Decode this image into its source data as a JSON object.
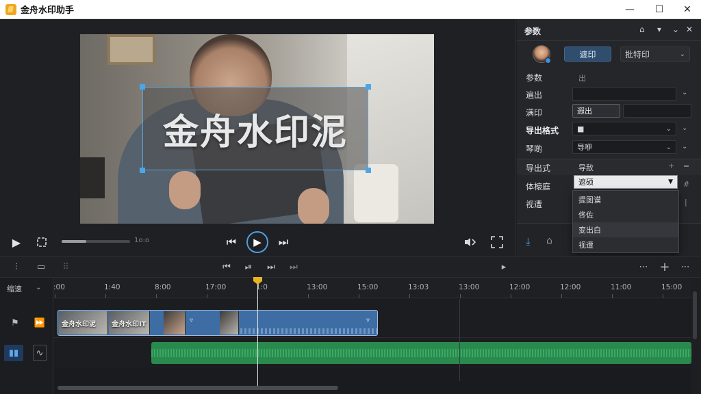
{
  "window": {
    "title": "金舟水印助手",
    "minimize": "—",
    "maximize": "☐",
    "close": "✕"
  },
  "preview": {
    "watermark_text": "金舟水印泥",
    "time": "1o:o"
  },
  "panel": {
    "title": "参数",
    "tab_active": "遮印",
    "tab_other": "批特印",
    "rows": {
      "r1_label": "参数",
      "r1_value": "出",
      "r2_label": "遍出",
      "r3_label": "满印",
      "r3_button": "遐出",
      "r4_label": "导出格式",
      "r4_value": "■",
      "r5_label": "琴啲",
      "r5_value": "导咿"
    },
    "section": {
      "label": "导出式",
      "value": "导敌",
      "plus": "+",
      "eq": "="
    },
    "row6_label": "体榱庭",
    "row6_mark": "#",
    "row7_label": "视遭",
    "row7_mark": "|",
    "dropdown": {
      "selected": "遮硕",
      "options": [
        "提图谟",
        "佟佐",
        "变出白",
        "视遭"
      ]
    }
  },
  "timeline": {
    "zoom_label": "缩速",
    "ticks": [
      ":00",
      "1:40",
      "8:00",
      "17:00",
      "1:0",
      "13:00",
      "15:00",
      "13:03",
      "13:00",
      "12:00",
      "12:00",
      "11:00",
      "15:00"
    ],
    "clip_thumb1": "金舟水印泥",
    "clip_thumb2": "金舟水印IT"
  }
}
